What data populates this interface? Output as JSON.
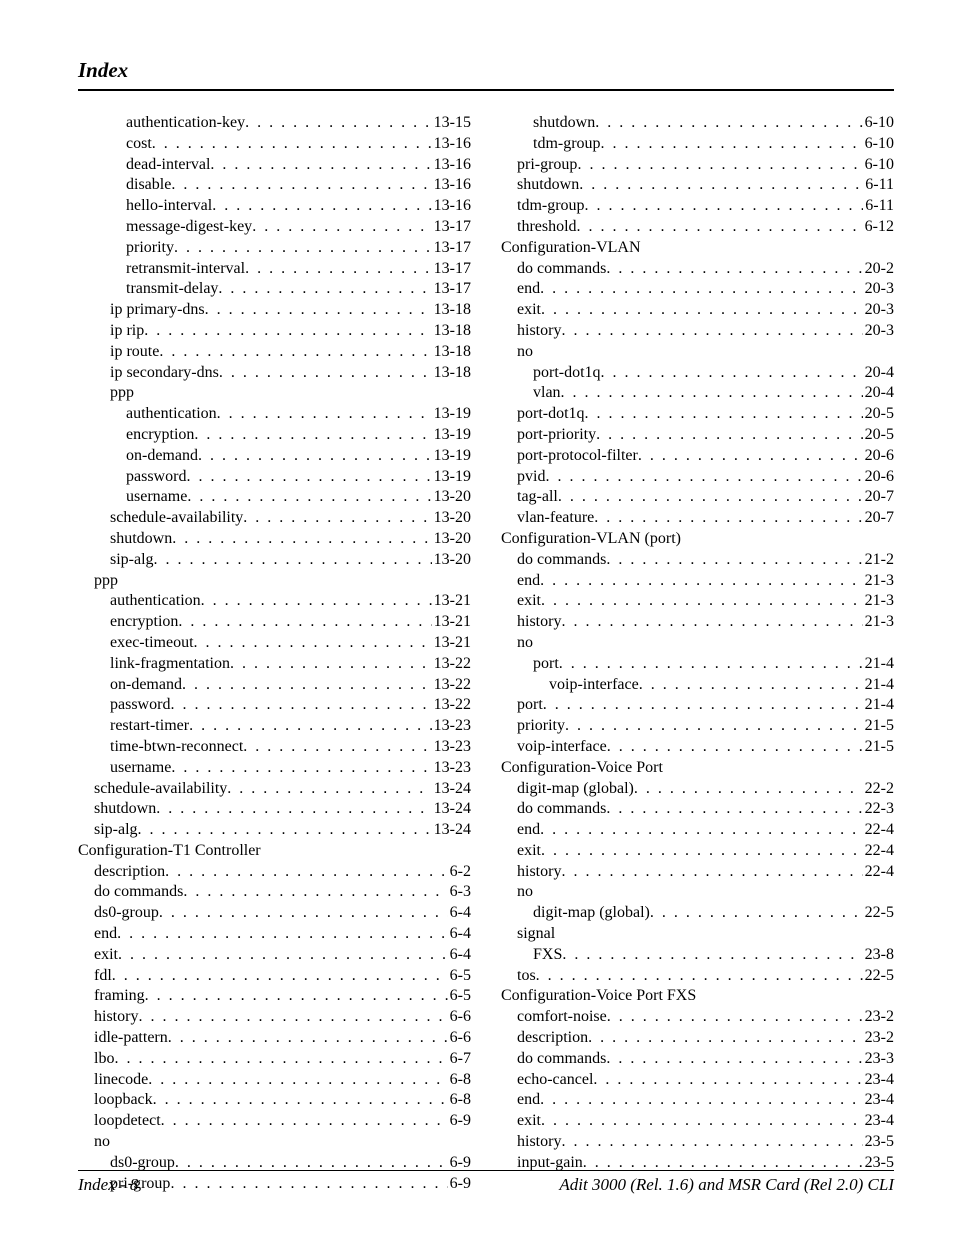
{
  "running_head": "Index",
  "footer_left": "Index - 8",
  "footer_right": "Adit 3000 (Rel. 1.6) and MSR Card (Rel 2.0) CLI",
  "lines": [
    {
      "indent": 3,
      "label": "authentication-key",
      "page": "13-15"
    },
    {
      "indent": 3,
      "label": "cost",
      "page": "13-16"
    },
    {
      "indent": 3,
      "label": "dead-interval",
      "page": "13-16"
    },
    {
      "indent": 3,
      "label": "disable",
      "page": "13-16"
    },
    {
      "indent": 3,
      "label": "hello-interval",
      "page": "13-16"
    },
    {
      "indent": 3,
      "label": "message-digest-key",
      "page": "13-17"
    },
    {
      "indent": 3,
      "label": "priority",
      "page": "13-17"
    },
    {
      "indent": 3,
      "label": "retransmit-interval",
      "page": "13-17"
    },
    {
      "indent": 3,
      "label": "transmit-delay",
      "page": "13-17"
    },
    {
      "indent": 2,
      "label": "ip primary-dns",
      "page": "13-18"
    },
    {
      "indent": 2,
      "label": "ip rip",
      "page": "13-18"
    },
    {
      "indent": 2,
      "label": "ip route",
      "page": "13-18"
    },
    {
      "indent": 2,
      "label": "ip secondary-dns",
      "page": "13-18"
    },
    {
      "indent": 2,
      "label": "ppp",
      "heading": true
    },
    {
      "indent": 3,
      "label": "authentication",
      "page": "13-19"
    },
    {
      "indent": 3,
      "label": "encryption",
      "page": "13-19"
    },
    {
      "indent": 3,
      "label": "on-demand",
      "page": "13-19"
    },
    {
      "indent": 3,
      "label": "password",
      "page": "13-19"
    },
    {
      "indent": 3,
      "label": "username",
      "page": "13-20"
    },
    {
      "indent": 2,
      "label": "schedule-availability",
      "page": "13-20"
    },
    {
      "indent": 2,
      "label": "shutdown",
      "page": "13-20"
    },
    {
      "indent": 2,
      "label": "sip-alg",
      "page": "13-20"
    },
    {
      "indent": 1,
      "label": "ppp",
      "heading": true
    },
    {
      "indent": 2,
      "label": "authentication",
      "page": "13-21"
    },
    {
      "indent": 2,
      "label": "encryption",
      "page": "13-21"
    },
    {
      "indent": 2,
      "label": "exec-timeout",
      "page": "13-21"
    },
    {
      "indent": 2,
      "label": "link-fragmentation",
      "page": "13-22"
    },
    {
      "indent": 2,
      "label": "on-demand",
      "page": "13-22"
    },
    {
      "indent": 2,
      "label": "password",
      "page": "13-22"
    },
    {
      "indent": 2,
      "label": "restart-timer",
      "page": "13-23"
    },
    {
      "indent": 2,
      "label": "time-btwn-reconnect",
      "page": "13-23"
    },
    {
      "indent": 2,
      "label": "username",
      "page": "13-23"
    },
    {
      "indent": 1,
      "label": "schedule-availability",
      "page": "13-24"
    },
    {
      "indent": 1,
      "label": "shutdown",
      "page": "13-24"
    },
    {
      "indent": 1,
      "label": "sip-alg",
      "page": "13-24"
    },
    {
      "indent": 0,
      "label": "Configuration-T1 Controller",
      "heading": true
    },
    {
      "indent": 1,
      "label": "description",
      "page": "6-2"
    },
    {
      "indent": 1,
      "label": "do commands",
      "page": "6-3"
    },
    {
      "indent": 1,
      "label": "ds0-group",
      "page": "6-4"
    },
    {
      "indent": 1,
      "label": "end",
      "page": "6-4"
    },
    {
      "indent": 1,
      "label": "exit",
      "page": "6-4"
    },
    {
      "indent": 1,
      "label": "fdl",
      "page": "6-5"
    },
    {
      "indent": 1,
      "label": "framing",
      "page": "6-5"
    },
    {
      "indent": 1,
      "label": "history",
      "page": "6-6"
    },
    {
      "indent": 1,
      "label": "idle-pattern",
      "page": "6-6"
    },
    {
      "indent": 1,
      "label": "lbo",
      "page": "6-7"
    },
    {
      "indent": 1,
      "label": "linecode",
      "page": "6-8"
    },
    {
      "indent": 1,
      "label": "loopback",
      "page": "6-8"
    },
    {
      "indent": 1,
      "label": "loopdetect",
      "page": "6-9"
    },
    {
      "indent": 1,
      "label": "no",
      "heading": true
    },
    {
      "indent": 2,
      "label": "ds0-group",
      "page": "6-9"
    },
    {
      "indent": 2,
      "label": "pri-group",
      "page": "6-9"
    },
    {
      "indent": 2,
      "label": "shutdown",
      "page": "6-10"
    },
    {
      "indent": 2,
      "label": "tdm-group",
      "page": "6-10"
    },
    {
      "indent": 1,
      "label": "pri-group",
      "page": "6-10"
    },
    {
      "indent": 1,
      "label": "shutdown",
      "page": "6-11"
    },
    {
      "indent": 1,
      "label": "tdm-group",
      "page": "6-11"
    },
    {
      "indent": 1,
      "label": "threshold",
      "page": "6-12"
    },
    {
      "indent": 0,
      "label": "Configuration-VLAN",
      "heading": true
    },
    {
      "indent": 1,
      "label": "do commands",
      "page": "20-2"
    },
    {
      "indent": 1,
      "label": "end",
      "page": "20-3"
    },
    {
      "indent": 1,
      "label": "exit",
      "page": "20-3"
    },
    {
      "indent": 1,
      "label": "history",
      "page": "20-3"
    },
    {
      "indent": 1,
      "label": "no",
      "heading": true
    },
    {
      "indent": 2,
      "label": "port-dot1q",
      "page": "20-4"
    },
    {
      "indent": 2,
      "label": "vlan",
      "page": "20-4"
    },
    {
      "indent": 1,
      "label": "port-dot1q",
      "page": "20-5"
    },
    {
      "indent": 1,
      "label": "port-priority",
      "page": "20-5"
    },
    {
      "indent": 1,
      "label": "port-protocol-filter",
      "page": "20-6"
    },
    {
      "indent": 1,
      "label": "pvid",
      "page": "20-6"
    },
    {
      "indent": 1,
      "label": "tag-all",
      "page": "20-7"
    },
    {
      "indent": 1,
      "label": "vlan-feature",
      "page": "20-7"
    },
    {
      "indent": 0,
      "label": "Configuration-VLAN (port)",
      "heading": true
    },
    {
      "indent": 1,
      "label": "do commands",
      "page": "21-2"
    },
    {
      "indent": 1,
      "label": "end",
      "page": "21-3"
    },
    {
      "indent": 1,
      "label": "exit",
      "page": "21-3"
    },
    {
      "indent": 1,
      "label": "history",
      "page": "21-3"
    },
    {
      "indent": 1,
      "label": "no",
      "heading": true
    },
    {
      "indent": 2,
      "label": "port",
      "page": "21-4"
    },
    {
      "indent": 3,
      "label": "voip-interface",
      "page": "21-4"
    },
    {
      "indent": 1,
      "label": "port",
      "page": "21-4"
    },
    {
      "indent": 1,
      "label": "priority",
      "page": "21-5"
    },
    {
      "indent": 1,
      "label": "voip-interface",
      "page": "21-5"
    },
    {
      "indent": 0,
      "label": "Configuration-Voice Port",
      "heading": true
    },
    {
      "indent": 1,
      "label": "digit-map (global)",
      "page": "22-2"
    },
    {
      "indent": 1,
      "label": "do commands",
      "page": "22-3"
    },
    {
      "indent": 1,
      "label": "end",
      "page": "22-4"
    },
    {
      "indent": 1,
      "label": "exit",
      "page": "22-4"
    },
    {
      "indent": 1,
      "label": "history",
      "page": "22-4"
    },
    {
      "indent": 1,
      "label": "no",
      "heading": true
    },
    {
      "indent": 2,
      "label": "digit-map (global)",
      "page": "22-5"
    },
    {
      "indent": 1,
      "label": "signal",
      "heading": true
    },
    {
      "indent": 2,
      "label": "FXS",
      "page": "23-8"
    },
    {
      "indent": 1,
      "label": "tos",
      "page": "22-5"
    },
    {
      "indent": 0,
      "label": "Configuration-Voice Port FXS",
      "heading": true
    },
    {
      "indent": 1,
      "label": "comfort-noise",
      "page": "23-2"
    },
    {
      "indent": 1,
      "label": "description",
      "page": "23-2"
    },
    {
      "indent": 1,
      "label": "do commands",
      "page": "23-3"
    },
    {
      "indent": 1,
      "label": "echo-cancel",
      "page": "23-4"
    },
    {
      "indent": 1,
      "label": "end",
      "page": "23-4"
    },
    {
      "indent": 1,
      "label": "exit",
      "page": "23-4"
    },
    {
      "indent": 1,
      "label": "history",
      "page": "23-5"
    },
    {
      "indent": 1,
      "label": "input-gain",
      "page": "23-5"
    }
  ]
}
